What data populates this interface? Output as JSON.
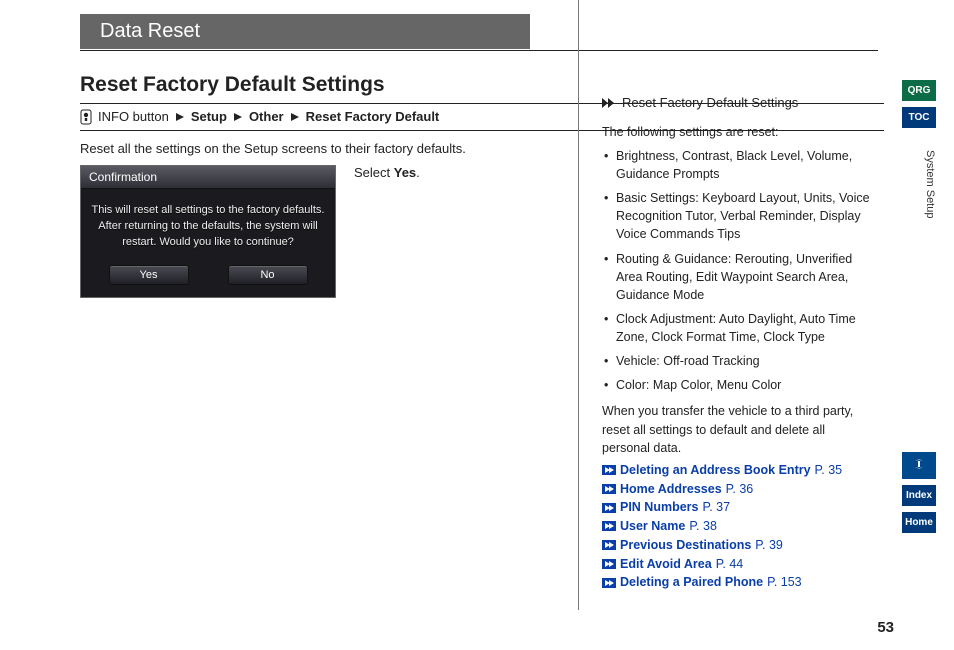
{
  "page_number": "53",
  "header_tab": "Data Reset",
  "section_title": "Reset Factory Default Settings",
  "breadcrumb": {
    "start": "INFO button",
    "steps": [
      "Setup",
      "Other",
      "Reset Factory Default"
    ]
  },
  "intro": "Reset all the settings on the Setup screens to their factory defaults.",
  "select_line": {
    "prefix": "Select ",
    "bold": "Yes",
    "suffix": "."
  },
  "dialog": {
    "title": "Confirmation",
    "body": "This will reset all settings to the factory defaults. After returning to the defaults, the system will restart.\nWould you like to continue?",
    "yes": "Yes",
    "no": "No"
  },
  "side": {
    "header": "Reset Factory Default Settings",
    "lead": "The following settings are reset:",
    "bullets": [
      "Brightness, Contrast, Black Level, Volume, Guidance Prompts",
      "Basic Settings: Keyboard Layout, Units, Voice Recognition Tutor, Verbal Reminder, Display Voice Commands Tips",
      "Routing & Guidance: Rerouting, Unverified Area Routing, Edit Waypoint Search Area, Guidance Mode",
      "Clock Adjustment: Auto Daylight, Auto Time Zone, Clock Format Time, Clock Type",
      "Vehicle: Off-road Tracking",
      "Color: Map Color, Menu Color"
    ],
    "note": "When you transfer the vehicle to a third party, reset all settings to default and delete all personal data.",
    "links": [
      {
        "label": "Deleting an Address Book Entry",
        "page": "P. 35"
      },
      {
        "label": "Home Addresses",
        "page": "P. 36"
      },
      {
        "label": "PIN Numbers",
        "page": "P. 37"
      },
      {
        "label": "User Name",
        "page": "P. 38"
      },
      {
        "label": "Previous Destinations",
        "page": "P. 39"
      },
      {
        "label": "Edit Avoid Area",
        "page": "P. 44"
      },
      {
        "label": "Deleting a Paired Phone",
        "page": "P. 153"
      }
    ]
  },
  "right_tabs": {
    "qrg": "QRG",
    "toc": "TOC",
    "section_label": "System Setup",
    "index": "Index",
    "home": "Home"
  }
}
